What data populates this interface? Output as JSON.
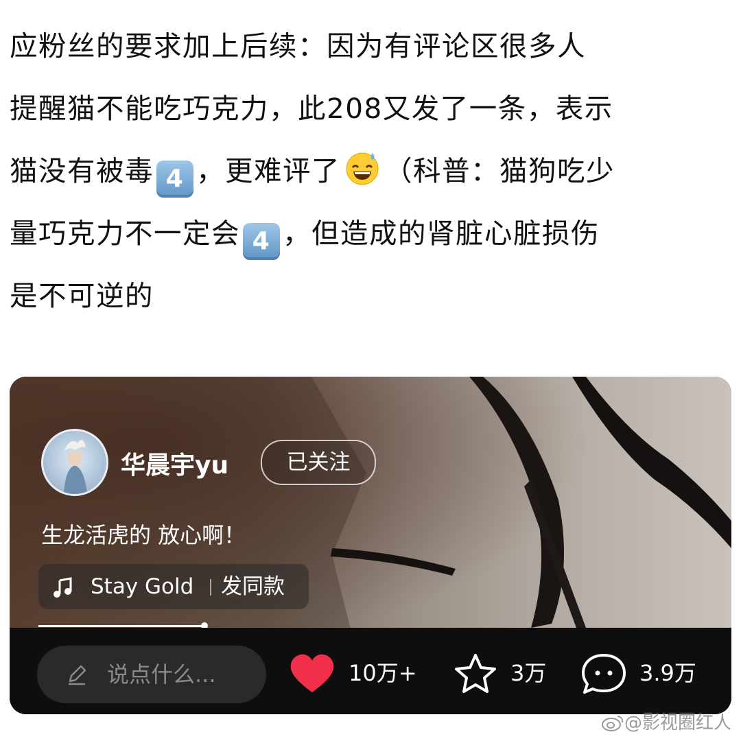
{
  "post": {
    "line1": "应粉丝的要求加上后续：因为有评论区很多人",
    "line2": "提醒猫不能吃巧克力，此208又发了一条，表示",
    "line3_a": "猫没有被毒",
    "line3_key": "4",
    "line3_b": "，更难评了",
    "line3_c": "（科普：猫狗吃少",
    "line4_a": "量巧克力不一定会",
    "line4_key": "4",
    "line4_b": "，但造成的肾脏心脏损伤",
    "line5": "是不可逆的"
  },
  "video": {
    "username": "华晨宇yu",
    "follow_label": "已关注",
    "caption": "生龙活虎的 放心啊！",
    "music": {
      "song": "Stay Gold",
      "use_same_label": "发同款"
    },
    "progress": 0.25,
    "comment_placeholder": "说点什么...",
    "likes": "10万+",
    "favorites": "3万",
    "comments": "3.9万"
  },
  "watermark": "@影视圈红人",
  "colors": {
    "like_heart": "#f0304a",
    "bar_background": "#0e0e0e",
    "text": "#111111"
  },
  "icons": [
    "keycap-4-icon",
    "grinning-sweat-emoji-icon",
    "music-note-icon",
    "pencil-icon",
    "heart-icon",
    "star-icon",
    "chat-bubble-icon",
    "weibo-logo-icon"
  ]
}
